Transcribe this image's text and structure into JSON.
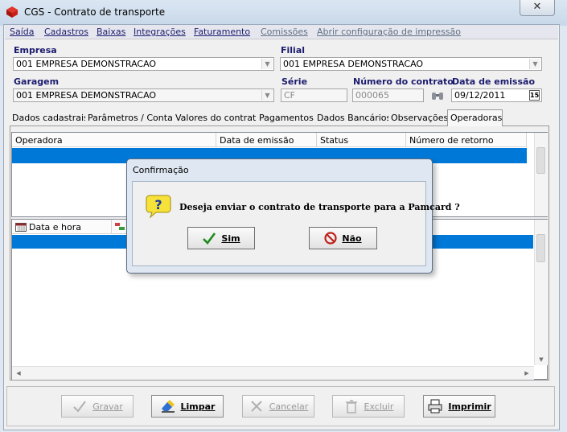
{
  "window": {
    "title": "CGS - Contrato de transporte",
    "close_label": "✕"
  },
  "menu": [
    {
      "label": "Saída",
      "enabled": true
    },
    {
      "label": "Cadastros",
      "enabled": true
    },
    {
      "label": "Baixas",
      "enabled": true
    },
    {
      "label": "Integrações",
      "enabled": true
    },
    {
      "label": "Faturamento",
      "enabled": true
    },
    {
      "label": "Comissões",
      "enabled": false
    },
    {
      "label": "Abrir configuração de impressão",
      "enabled": false
    }
  ],
  "form": {
    "empresa": {
      "label": "Empresa",
      "value": "001 EMPRESA DEMONSTRACAO"
    },
    "filial": {
      "label": "Filial",
      "value": "001 EMPRESA DEMONSTRACAO"
    },
    "garagem": {
      "label": "Garagem",
      "value": "001 EMPRESA DEMONSTRACAO"
    },
    "serie": {
      "label": "Série",
      "value": "CF"
    },
    "numero_contrato": {
      "label": "Número do contrato",
      "value": "000065"
    },
    "data_emissao": {
      "label": "Data de emissão",
      "value": "09/12/2011",
      "calendar_glyph": "15"
    }
  },
  "tabs": [
    {
      "label": "Dados cadastrais"
    },
    {
      "label": "Parâmetros / Contas"
    },
    {
      "label": "Valores do contrato"
    },
    {
      "label": "Pagamentos"
    },
    {
      "label": "Dados Bancários"
    },
    {
      "label": "Observações"
    },
    {
      "label": "Operadoras",
      "active": true
    }
  ],
  "grid1": {
    "columns": [
      "Operadora",
      "Data de emissão",
      "Status",
      "Número de retorno"
    ]
  },
  "grid2": {
    "columns": [
      "Data e hora"
    ]
  },
  "toolbar": {
    "gravar": "Gravar",
    "limpar": "Limpar",
    "cancelar": "Cancelar",
    "excluir": "Excluir",
    "imprimir": "Imprimir"
  },
  "dialog": {
    "title": "Confirmação",
    "message": "Deseja enviar o contrato de transporte para a Pamcard ?",
    "yes_label": "Sim",
    "no_label": "Não"
  },
  "colors": {
    "selection": "#0078d7",
    "label_blue": "#1b1b6e"
  }
}
